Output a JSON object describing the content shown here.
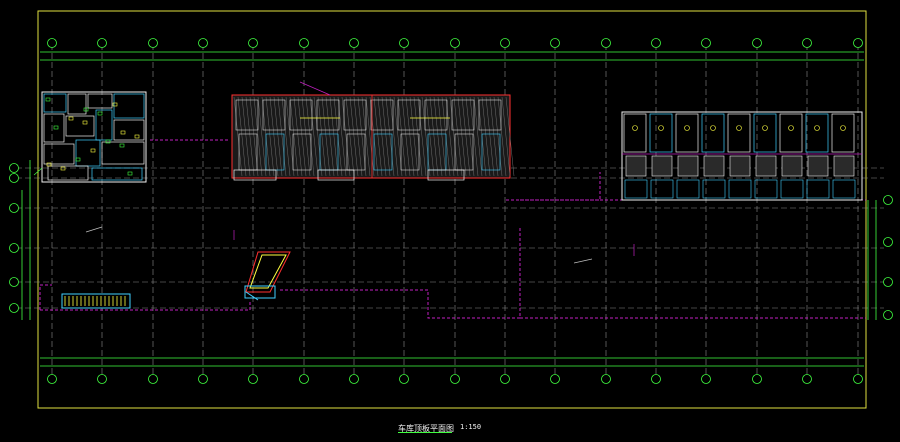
{
  "drawing": {
    "title": "车库顶板平面图",
    "scale": "1:150"
  },
  "grid": {
    "column_labels": [
      "",
      "",
      "",
      "",
      "",
      "",
      "",
      "",
      "",
      "",
      "",
      "",
      "",
      "",
      "",
      "",
      ""
    ],
    "row_labels": [
      "",
      "",
      "",
      "",
      "",
      ""
    ]
  },
  "colors": {
    "background": "#000000",
    "frame": "#e0e040",
    "gridline": "#8a8a8a",
    "dimension": "#40ff40",
    "bubble": "#40ff40",
    "wall": "#f0f0f0",
    "fixture": "#40d0ff",
    "hatch": "#c8c8c8",
    "boundary": "#c020c0",
    "red_outline": "#ff3030",
    "yellow_detail": "#ffff40"
  }
}
